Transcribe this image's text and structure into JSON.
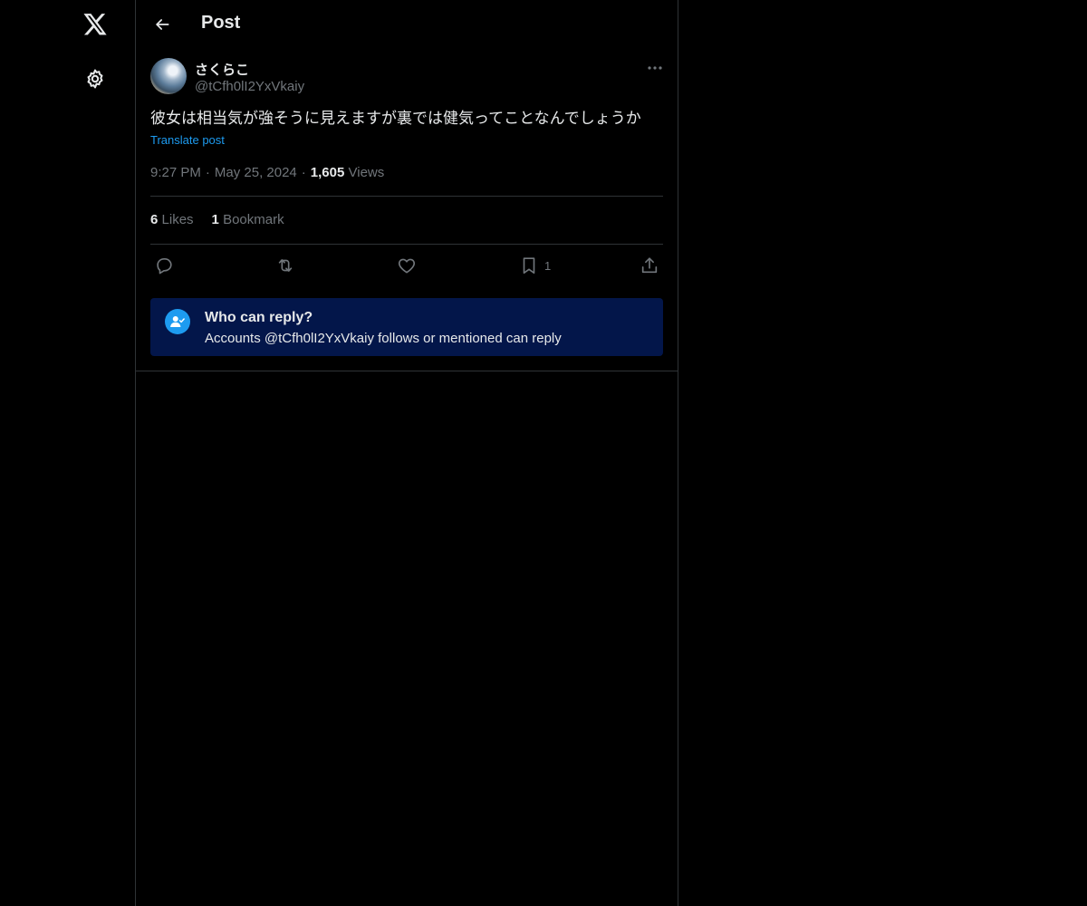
{
  "nav": {
    "logo_icon": "x-logo-icon",
    "settings_icon": "gear-icon"
  },
  "header": {
    "back_icon": "arrow-left-icon",
    "title": "Post"
  },
  "post": {
    "author": {
      "display_name": "さくらこ",
      "handle": "@tCfh0lI2YxVkaiy"
    },
    "text": "彼女は相当気が強そうに見えますが裏では健気ってことなんでしょうか",
    "translate_label": "Translate post",
    "time": "9:27 PM",
    "date": "May 25, 2024",
    "views_count": "1,605",
    "views_label": "Views",
    "stats": {
      "likes_count": "6",
      "likes_label": "Likes",
      "bookmarks_count": "1",
      "bookmarks_label": "Bookmark"
    },
    "actions": {
      "reply_icon": "reply-icon",
      "repost_icon": "repost-icon",
      "like_icon": "heart-icon",
      "bookmark_icon": "bookmark-icon",
      "bookmark_count": "1",
      "share_icon": "share-icon"
    }
  },
  "reply_settings": {
    "title": "Who can reply?",
    "description": "Accounts @tCfh0lI2YxVkaiy follows or mentioned can reply"
  },
  "colors": {
    "background": "#000000",
    "border": "#2f3336",
    "text_primary": "#e7e9ea",
    "text_secondary": "#71767b",
    "accent": "#1d9bf0",
    "reply_box_bg": "#03164a"
  }
}
